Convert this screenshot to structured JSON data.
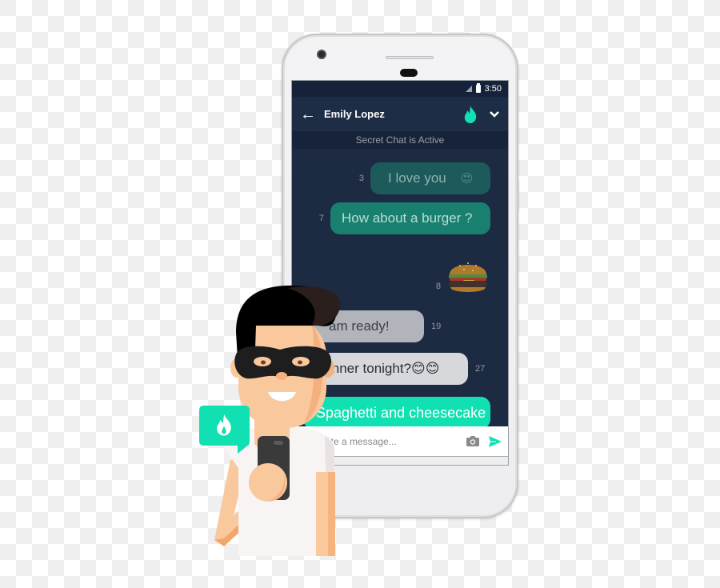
{
  "status_bar": {
    "time": "3:50",
    "icons": [
      "signal-icon",
      "battery-icon"
    ]
  },
  "header": {
    "back_icon": "arrow-left-icon",
    "contact_name": "Emily Lopez",
    "secret_icon": "flame-icon",
    "menu_icon": "chevron-down-icon"
  },
  "banner": {
    "text": "Secret Chat is Active"
  },
  "messages": [
    {
      "text": "I love you",
      "emoji": "😍",
      "count": "3",
      "side": "sent",
      "state": "fading"
    },
    {
      "text": "How about a burger ?",
      "count": "7",
      "side": "sent",
      "state": "normal"
    },
    {
      "text": "🍔",
      "count": "8",
      "side": "sent",
      "type": "sticker"
    },
    {
      "text": "I am ready!",
      "visible_text": "am ready!",
      "count": "19",
      "side": "received",
      "state": "fading"
    },
    {
      "text": "Dinner tonight?😊😊",
      "visible_text": "inner tonight?😊😊",
      "count": "27",
      "side": "received",
      "state": "normal"
    },
    {
      "text": "Spaghetti and cheesecake",
      "side": "sent",
      "state": "new"
    }
  ],
  "composer": {
    "placeholder": "Write a message...",
    "visible_placeholder": "ite a message...",
    "camera_icon": "camera-icon",
    "send_icon": "send-icon"
  },
  "illustration": {
    "badge_icon": "flame-icon",
    "description": "masked man holding phone"
  },
  "colors": {
    "screen_bg": "#1d2b42",
    "accent": "#10e0b2",
    "teal_bubble": "#19806f",
    "received_bubble": "#d6d8db"
  }
}
